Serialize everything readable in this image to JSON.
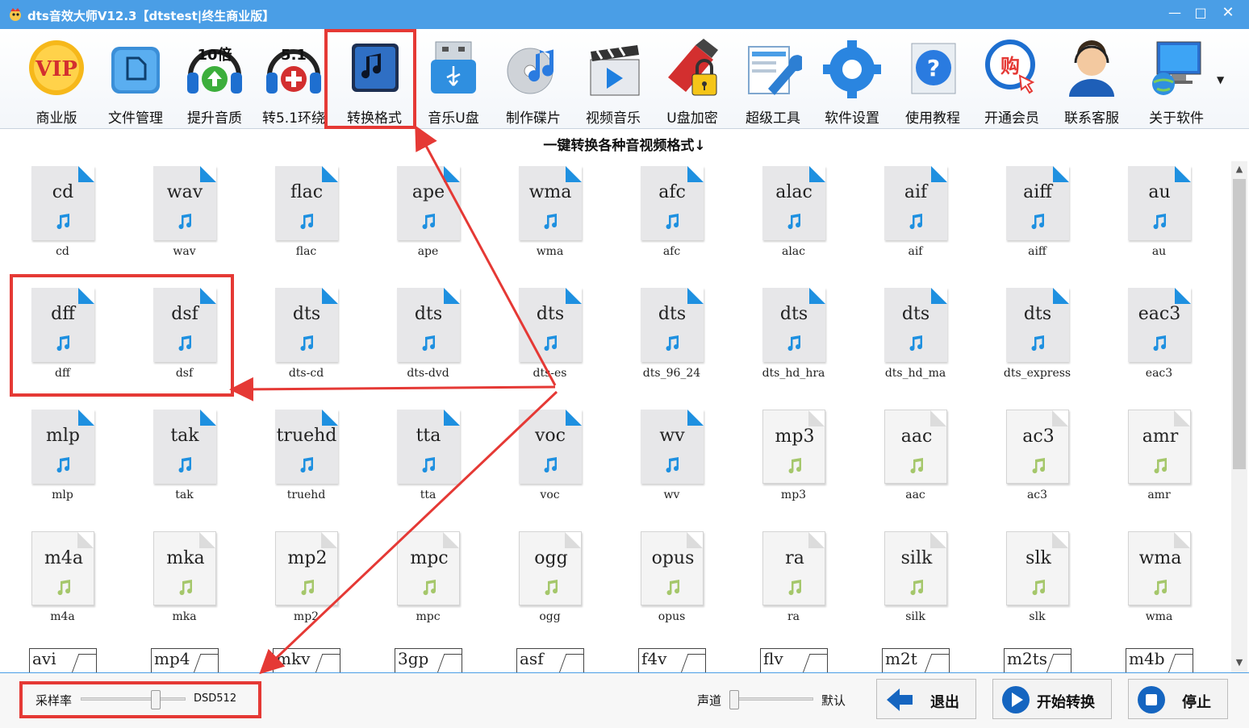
{
  "window": {
    "title": "dts音效大师V12.3【dtstest|终生商业版】",
    "min_glyph": "—",
    "max_glyph": "□",
    "close_glyph": "✕"
  },
  "toolbar": {
    "items": [
      {
        "label": "商业版",
        "icon": "vip-icon"
      },
      {
        "label": "文件管理",
        "icon": "folder-icon"
      },
      {
        "label": "提升音质",
        "icon": "headphones-10x-icon"
      },
      {
        "label": "转5.1环绕",
        "icon": "headphones-51-icon"
      },
      {
        "label": "转换格式",
        "icon": "music-note-icon"
      },
      {
        "label": "音乐U盘",
        "icon": "usb-drive-icon"
      },
      {
        "label": "制作碟片",
        "icon": "cd-disc-icon"
      },
      {
        "label": "视频音乐",
        "icon": "clapperboard-icon"
      },
      {
        "label": "U盘加密",
        "icon": "usb-lock-icon"
      },
      {
        "label": "超级工具",
        "icon": "wrench-icon"
      },
      {
        "label": "软件设置",
        "icon": "gear-icon"
      },
      {
        "label": "使用教程",
        "icon": "help-icon"
      },
      {
        "label": "开通会员",
        "icon": "shopping-cursor-icon"
      },
      {
        "label": "联系客服",
        "icon": "support-agent-icon"
      },
      {
        "label": "关于软件",
        "icon": "computer-globe-icon"
      }
    ],
    "dropdown_glyph": "▼"
  },
  "section_title": "一键转换各种音视频格式↓",
  "formats": [
    {
      "ext": "cd",
      "caption": "cd",
      "style": "blue"
    },
    {
      "ext": "wav",
      "caption": "wav",
      "style": "blue"
    },
    {
      "ext": "flac",
      "caption": "flac",
      "style": "blue"
    },
    {
      "ext": "ape",
      "caption": "ape",
      "style": "blue"
    },
    {
      "ext": "wma",
      "caption": "wma",
      "style": "blue"
    },
    {
      "ext": "afc",
      "caption": "afc",
      "style": "blue"
    },
    {
      "ext": "alac",
      "caption": "alac",
      "style": "blue"
    },
    {
      "ext": "aif",
      "caption": "aif",
      "style": "blue"
    },
    {
      "ext": "aiff",
      "caption": "aiff",
      "style": "blue"
    },
    {
      "ext": "au",
      "caption": "au",
      "style": "blue"
    },
    {
      "ext": "dff",
      "caption": "dff",
      "style": "blue"
    },
    {
      "ext": "dsf",
      "caption": "dsf",
      "style": "blue"
    },
    {
      "ext": "dts",
      "caption": "dts-cd",
      "style": "blue"
    },
    {
      "ext": "dts",
      "caption": "dts-dvd",
      "style": "blue"
    },
    {
      "ext": "dts",
      "caption": "dts-es",
      "style": "blue"
    },
    {
      "ext": "dts",
      "caption": "dts_96_24",
      "style": "blue"
    },
    {
      "ext": "dts",
      "caption": "dts_hd_hra",
      "style": "blue"
    },
    {
      "ext": "dts",
      "caption": "dts_hd_ma",
      "style": "blue"
    },
    {
      "ext": "dts",
      "caption": "dts_express",
      "style": "blue"
    },
    {
      "ext": "eac3",
      "caption": "eac3",
      "style": "blue"
    },
    {
      "ext": "mlp",
      "caption": "mlp",
      "style": "blue"
    },
    {
      "ext": "tak",
      "caption": "tak",
      "style": "blue"
    },
    {
      "ext": "truehd",
      "caption": "truehd",
      "style": "blue"
    },
    {
      "ext": "tta",
      "caption": "tta",
      "style": "blue"
    },
    {
      "ext": "voc",
      "caption": "voc",
      "style": "blue"
    },
    {
      "ext": "wv",
      "caption": "wv",
      "style": "blue"
    },
    {
      "ext": "mp3",
      "caption": "mp3",
      "style": "green"
    },
    {
      "ext": "aac",
      "caption": "aac",
      "style": "green"
    },
    {
      "ext": "ac3",
      "caption": "ac3",
      "style": "green"
    },
    {
      "ext": "amr",
      "caption": "amr",
      "style": "green"
    },
    {
      "ext": "m4a",
      "caption": "m4a",
      "style": "green"
    },
    {
      "ext": "mka",
      "caption": "mka",
      "style": "green"
    },
    {
      "ext": "mp2",
      "caption": "mp2",
      "style": "green"
    },
    {
      "ext": "mpc",
      "caption": "mpc",
      "style": "green"
    },
    {
      "ext": "ogg",
      "caption": "ogg",
      "style": "green"
    },
    {
      "ext": "opus",
      "caption": "opus",
      "style": "green"
    },
    {
      "ext": "ra",
      "caption": "ra",
      "style": "green"
    },
    {
      "ext": "silk",
      "caption": "silk",
      "style": "green"
    },
    {
      "ext": "slk",
      "caption": "slk",
      "style": "green"
    },
    {
      "ext": "wma",
      "caption": "wma",
      "style": "green"
    }
  ],
  "video_formats": [
    "avi",
    "mp4",
    "mkv",
    "3gp",
    "asf",
    "f4v",
    "flv",
    "m2t",
    "m2ts",
    "m4b"
  ],
  "bottom": {
    "sample_rate_label": "采样率",
    "sample_rate_value": "DSD512",
    "channel_label": "声道",
    "channel_value": "默认",
    "exit_label": "退出",
    "start_label": "开始转换",
    "stop_label": "停止"
  },
  "colors": {
    "titlebar": "#4a9ee6",
    "file_corner": "#1e90e0",
    "annotation_red": "#e53935"
  }
}
